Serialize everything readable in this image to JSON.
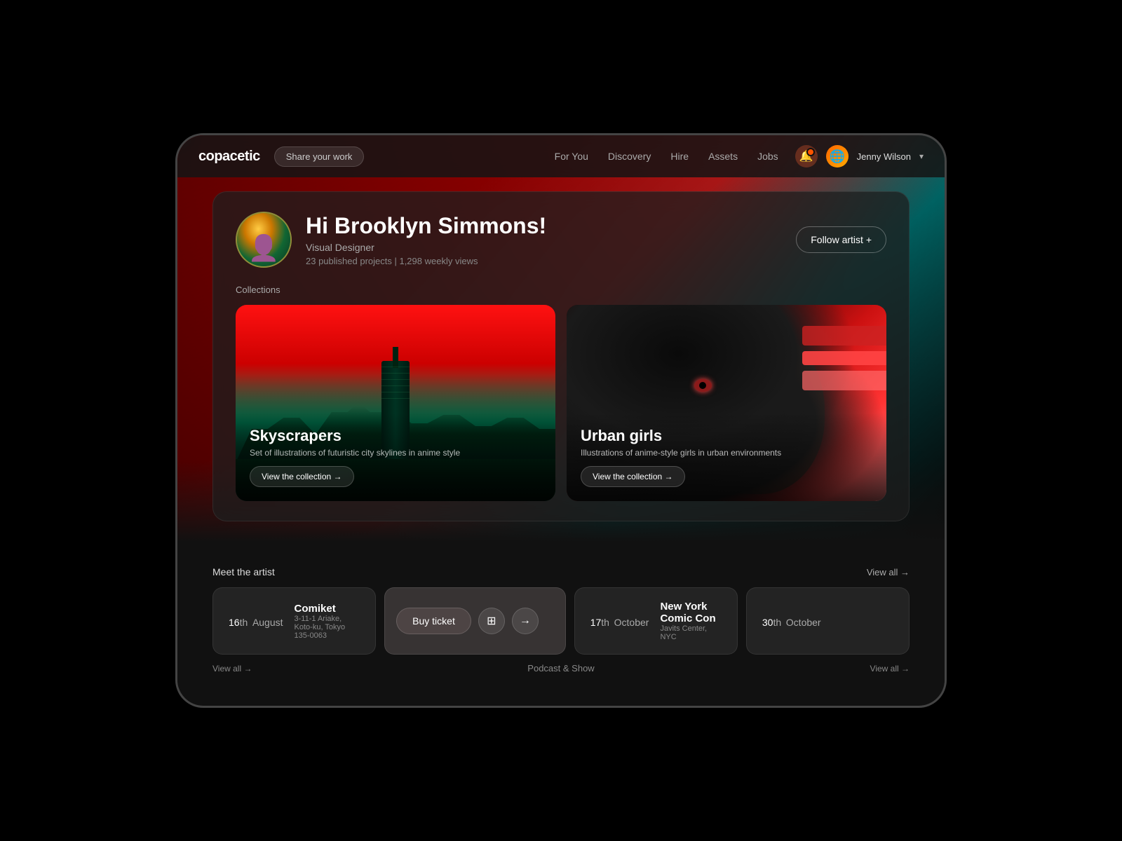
{
  "app": {
    "logo": "copacetic",
    "share_btn": "Share your work"
  },
  "nav": {
    "links": [
      "For You",
      "Discovery",
      "Hire",
      "Assets",
      "Jobs"
    ],
    "user_name": "Jenny Wilson"
  },
  "artist": {
    "greeting": "Hi Brooklyn Simmons!",
    "title": "Visual Designer",
    "stats": "23 published projects | 1,298 weekly views",
    "follow_btn": "Follow artist +"
  },
  "collections": {
    "label": "Collections",
    "items": [
      {
        "id": "skyscrapers",
        "title": "Skyscrapers",
        "desc": "Set of illustrations of futuristic city skylines in anime style",
        "view_btn": "View the collection →"
      },
      {
        "id": "urban-girls",
        "title": "Urban girls",
        "desc": "Illustrations of anime-style girls in urban environments",
        "view_btn": "View the collection →"
      }
    ]
  },
  "meet_artist": {
    "label": "Meet the artist",
    "view_all": "View all →"
  },
  "events": [
    {
      "day": "16",
      "suffix": "th",
      "month": "August",
      "name": "Comiket",
      "location": "3-11-1 Ariake, Koto-ku, Tokyo 135-0063"
    },
    {
      "buy_ticket": "Buy ticket",
      "qr_icon": "⊞",
      "arrow_icon": "→"
    },
    {
      "day": "17",
      "suffix": "th",
      "month": "October",
      "name": "New York Comic Con",
      "location": "Javits Center, NYC"
    },
    {
      "day": "30",
      "suffix": "th",
      "month": "October",
      "name": ""
    }
  ],
  "view_all_1": "View all →",
  "podcast": {
    "label": "Podcast & Show"
  },
  "view_all_2": "View all →"
}
